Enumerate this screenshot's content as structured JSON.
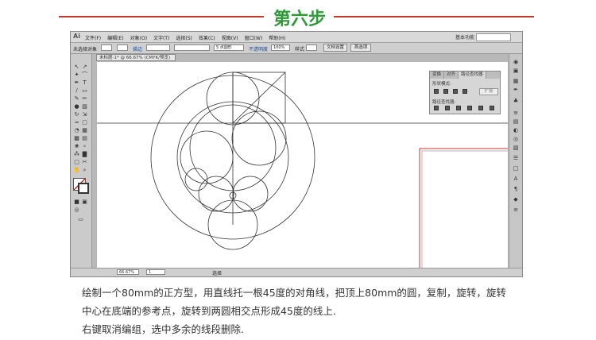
{
  "header": {
    "title": "第六步",
    "line_color": "#c0392b",
    "title_color": "#2e9a38"
  },
  "app": {
    "logo": "Ai",
    "menus": [
      "文件(F)",
      "编辑(E)",
      "对象(O)",
      "文字(T)",
      "选择(S)",
      "效果(C)",
      "视图(V)",
      "窗口(W)",
      "帮助(H)"
    ],
    "workspace_label": "基本功能",
    "control_bar": {
      "selection_state": "未选择对象",
      "stroke_label": "描边",
      "brush_value": "5 点圆形",
      "opacity_label": "不透明度",
      "opacity_value": "100%",
      "style_label": "样式",
      "doc_setup_button": "文档设置",
      "preferences_button": "首选项"
    },
    "doc_tab": "未标题-1* @ 66.67% (CMYK/预览)",
    "status": {
      "zoom": "66.67%",
      "page": "1",
      "selection_tool": "选择"
    },
    "pathfinder_panel": {
      "tabs": [
        "变换",
        "对齐",
        "路径查找器"
      ],
      "active_tab": "路径查找器",
      "shape_modes_label": "形状模式:",
      "pathfinders_label": "路径查找器:",
      "expand_button": "扩展"
    }
  },
  "caption": {
    "line1": "绘制一个80mm的正方型，用直线托一根45度的对角线，把顶上80mm的圆，复制，旋转，旋转",
    "line2": "中心在底端的参考点，旋转到两圆相交点形成45度的线上.",
    "line3": "右键取消编组，选中多余的线段删除."
  }
}
